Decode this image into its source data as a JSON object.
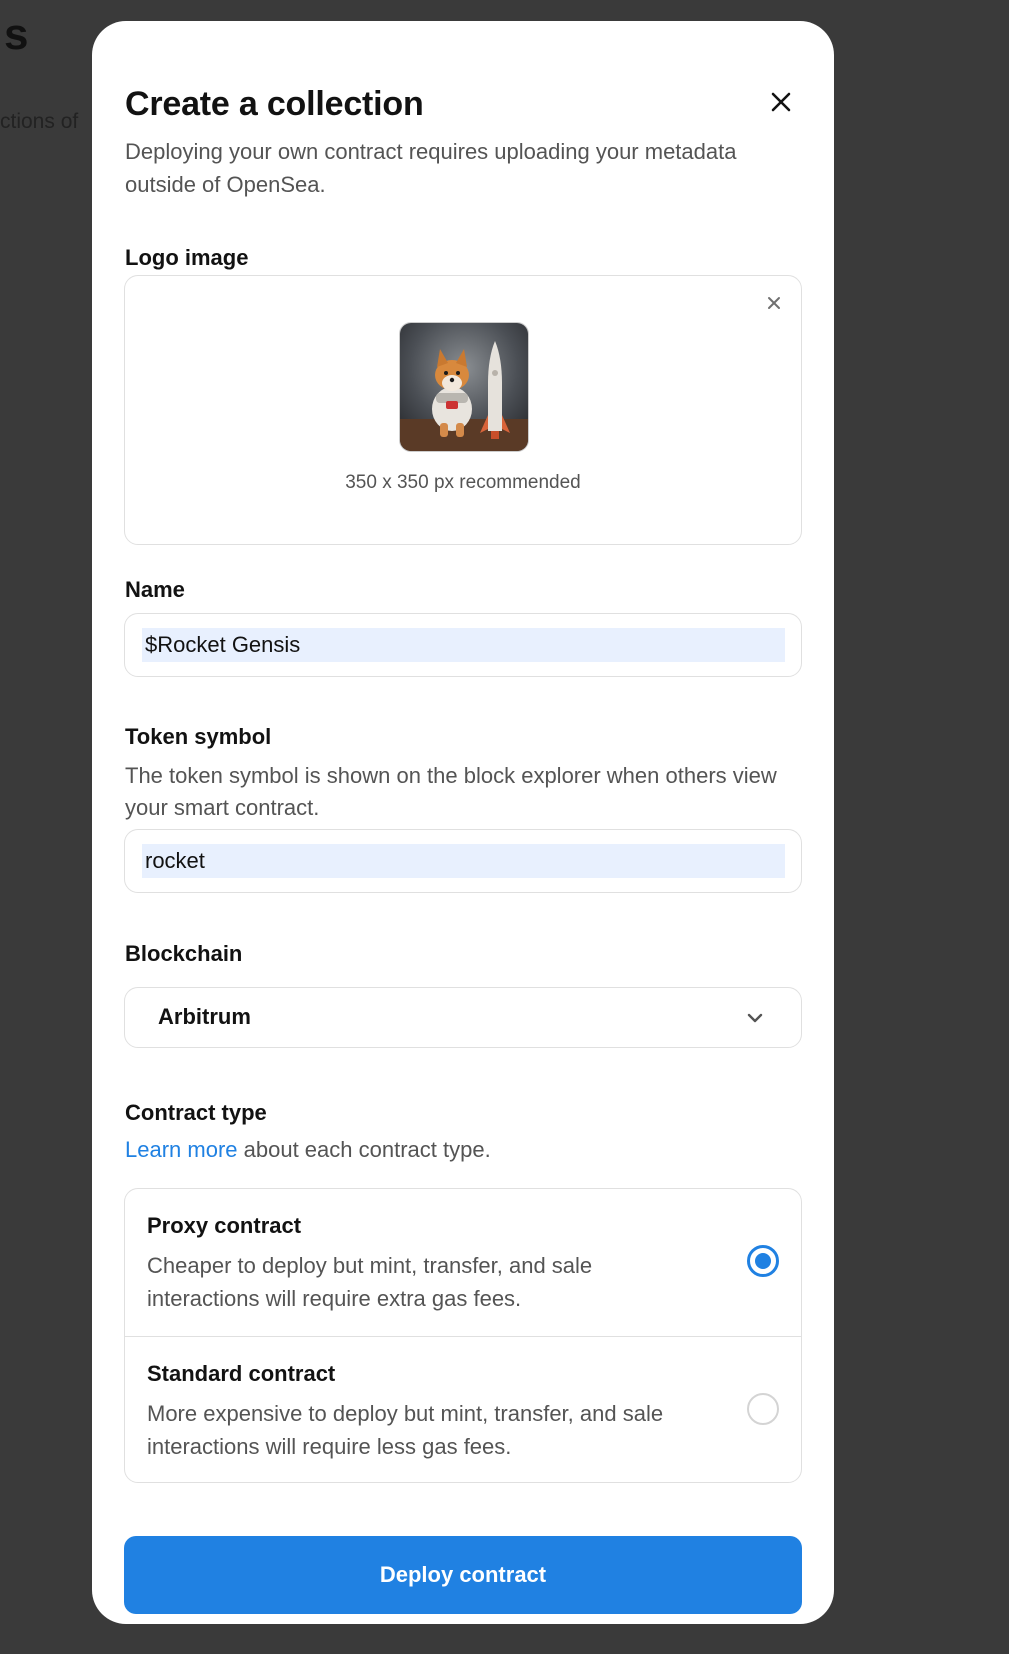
{
  "background": {
    "heading": "s",
    "subtext": "ctions of"
  },
  "modal": {
    "title": "Create a collection",
    "description": "Deploying your own contract requires uploading your metadata outside of OpenSea.",
    "close_icon": "close-icon"
  },
  "logo": {
    "label": "Logo image",
    "hint": "350 x 350 px recommended",
    "remove_icon": "close-icon",
    "thumbnail": "shiba-astronaut-with-rocket"
  },
  "name": {
    "label": "Name",
    "value": "$Rocket Gensis"
  },
  "token": {
    "label": "Token symbol",
    "help": "The token symbol is shown on the block explorer when others view your smart contract.",
    "value": "rocket"
  },
  "blockchain": {
    "label": "Blockchain",
    "selected": "Arbitrum",
    "chevron_icon": "chevron-down-icon"
  },
  "contract": {
    "label": "Contract type",
    "learn_link": "Learn more",
    "learn_suffix": " about each contract type.",
    "options": [
      {
        "title": "Proxy contract",
        "description": "Cheaper to deploy but mint, transfer, and sale interactions will require extra gas fees.",
        "selected": true
      },
      {
        "title": "Standard contract",
        "description": "More expensive to deploy but mint, transfer, and sale interactions will require less gas fees.",
        "selected": false
      }
    ]
  },
  "deploy_button": "Deploy contract",
  "colors": {
    "accent": "#2081e2",
    "overlay": "#3a3a3a",
    "autofill": "#e8f0fe",
    "muted_text": "#545454"
  }
}
